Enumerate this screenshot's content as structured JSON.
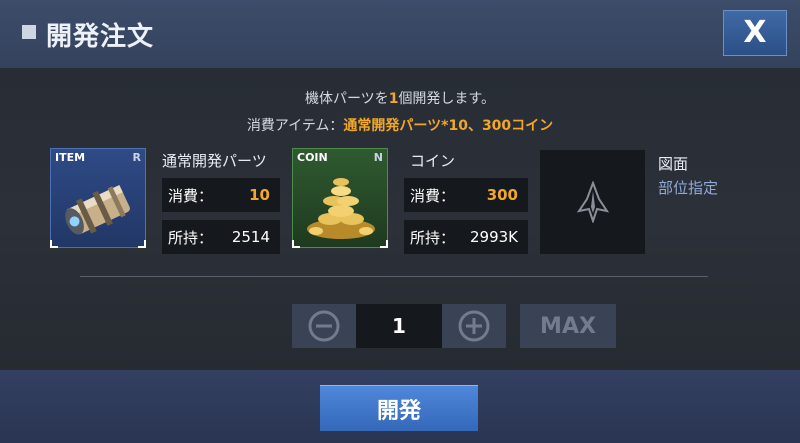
{
  "header": {
    "title": "開発注文",
    "close_label": "X"
  },
  "description": {
    "line1_prefix": "機体パーツを",
    "line1_count": "1",
    "line1_suffix": "個開発します。",
    "line2_prefix": "消費アイテム：",
    "line2_items": "通常開発パーツ*10、300コイン"
  },
  "item_card": {
    "tag": "ITEM",
    "rank": "R",
    "name": "通常開発パーツ",
    "consume_label": "消費：",
    "consume_value": "10",
    "owned_label": "所持：",
    "owned_value": "2514"
  },
  "coin_card": {
    "tag": "COIN",
    "rank": "N",
    "name": "コイン",
    "consume_label": "消費：",
    "consume_value": "300",
    "owned_label": "所持：",
    "owned_value": "2993K"
  },
  "blueprint": {
    "title": "図面",
    "link": "部位指定"
  },
  "quantity": {
    "value": "1",
    "max_label": "MAX"
  },
  "footer": {
    "develop_label": "開発"
  },
  "colors": {
    "accent": "#f0a72c",
    "button_blue": "#3f6aa6",
    "link": "#8fa9d9"
  }
}
